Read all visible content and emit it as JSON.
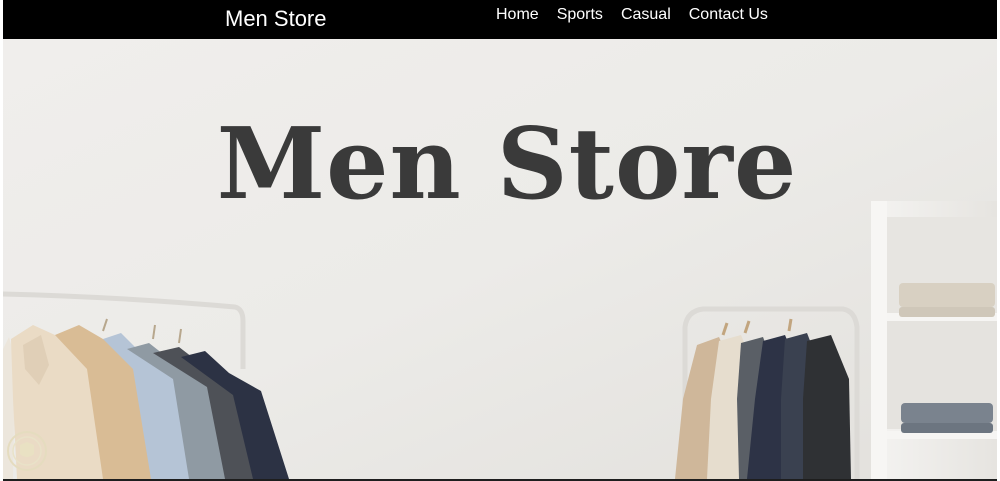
{
  "navbar": {
    "brand": "Men Store",
    "links": [
      "Home",
      "Sports",
      "Casual",
      "Contact Us"
    ]
  },
  "hero": {
    "title": "Men Store",
    "image_alt_icon": "clothing-racks-scene"
  },
  "colors": {
    "navbar_bg": "#000000",
    "nav_text": "#ffffff",
    "hero_wall": "#ebe9e6",
    "hero_title": "#3a3a3a"
  },
  "icons": {
    "seal": "watermark-seal-icon"
  }
}
